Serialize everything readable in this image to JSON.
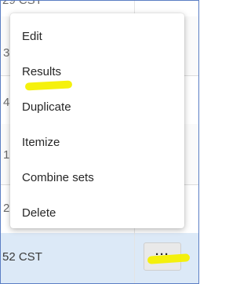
{
  "background_rows": {
    "top_partial": "29 CST",
    "left_fragments": [
      "3",
      "4",
      "1",
      "2"
    ],
    "active_row": "52 CST"
  },
  "context_menu": {
    "items": [
      {
        "label": "Edit"
      },
      {
        "label": "Results"
      },
      {
        "label": "Duplicate"
      },
      {
        "label": "Itemize"
      },
      {
        "label": "Combine sets"
      },
      {
        "label": "Delete"
      }
    ]
  },
  "more_button": {
    "label": "···",
    "icon": "more-horizontal-icon"
  },
  "highlight_color": "#f4f000"
}
